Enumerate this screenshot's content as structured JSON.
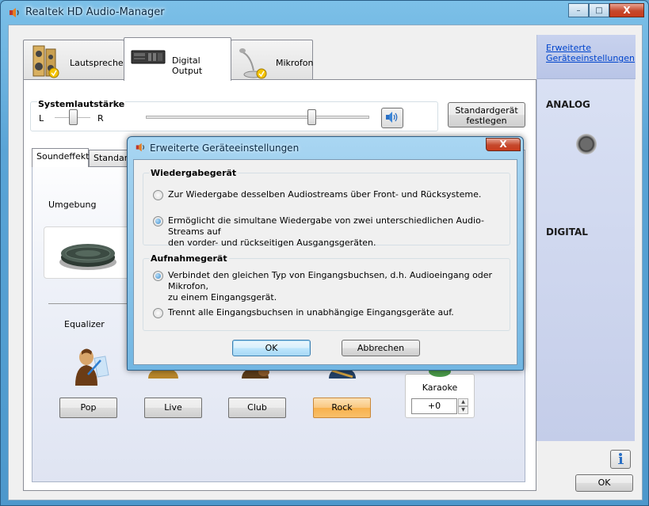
{
  "window": {
    "title": "Realtek HD Audio-Manager",
    "buttons": {
      "minimize": "–",
      "maximize": "□",
      "close": "X"
    }
  },
  "tabs": [
    {
      "label": "Lautsprecher",
      "icon": "speaker-icon"
    },
    {
      "label": "Digital Output",
      "icon": "digital-output-icon"
    },
    {
      "label": "Mikrofon",
      "icon": "microphone-icon"
    }
  ],
  "volume": {
    "title": "Systemlautstärke",
    "left": "L",
    "right": "R",
    "balance_level": 0.5,
    "volume_level": 0.74
  },
  "standard_device_button": {
    "line1": "Standardgerät",
    "line2": "festlegen"
  },
  "inner_tabs": [
    {
      "label": "Soundeffekt"
    },
    {
      "label": "Standard"
    }
  ],
  "environment_label": "Umgebung",
  "equalizer_label": "Equalizer",
  "equalizer_presets": [
    {
      "label": "Pop",
      "selected": false
    },
    {
      "label": "Live",
      "selected": false
    },
    {
      "label": "Club",
      "selected": false
    },
    {
      "label": "Rock",
      "selected": true
    }
  ],
  "karaoke": {
    "label": "Karaoke",
    "value": "+0"
  },
  "sidebar": {
    "link_line1": "Erweiterte",
    "link_line2": "Geräteeinstellungen",
    "analog": "ANALOG",
    "digital": "DIGITAL"
  },
  "main_ok": "OK",
  "dialog": {
    "title": "Erweiterte Geräteeinstellungen",
    "close": "X",
    "playback_group": {
      "title": "Wiedergabegerät",
      "options": [
        {
          "text": "Zur Wiedergabe desselben Audiostreams über Front- und Rücksysteme.",
          "checked": false
        },
        {
          "text_line1": "Ermöglicht die simultane Wiedergabe von zwei unterschiedlichen Audio-Streams auf",
          "text_line2": "den vorder- und rückseitigen Ausgangsgeräten.",
          "checked": true
        }
      ]
    },
    "record_group": {
      "title": "Aufnahmegerät",
      "options": [
        {
          "text_line1": "Verbindet den gleichen Typ von Eingangsbuchsen, d.h. Audioeingang oder Mikrofon,",
          "text_line2": "zu einem Eingangsgerät.",
          "checked": true
        },
        {
          "text": "Trennt alle Eingangsbuchsen in unabhängige Eingangsgeräte auf.",
          "checked": false
        }
      ]
    },
    "ok": "OK",
    "cancel": "Abbrechen"
  },
  "colors": {
    "titlebar": "#5fa8d6",
    "rock_selected": "#f9c06b",
    "link": "#0044cc",
    "sidebar": "#c4cde9"
  }
}
